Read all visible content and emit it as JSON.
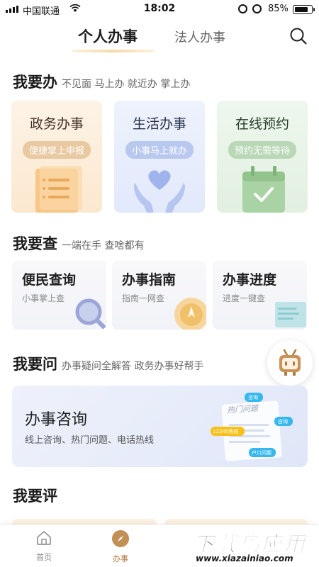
{
  "status_bar": {
    "carrier": "中国联通",
    "time": "18:02",
    "battery": "85%",
    "battery_level": 0.85
  },
  "tabs": {
    "active": "个人办事",
    "inactive": "法人办事"
  },
  "sections": {
    "do": {
      "title": "我要办",
      "subtitle": "不见面 马上办 就近办 掌上办"
    },
    "query": {
      "title": "我要查",
      "subtitle": "一端在手 查啥都有"
    },
    "ask": {
      "title": "我要问",
      "subtitle": "办事疑问全解答 政务办事好帮手"
    },
    "rate": {
      "title": "我要评"
    }
  },
  "do_cards": [
    {
      "title": "政务办事",
      "tag": "便捷掌上申报"
    },
    {
      "title": "生活办事",
      "tag": "小事马上就办"
    },
    {
      "title": "在线预约",
      "tag": "预约无需等待"
    }
  ],
  "query_cards": [
    {
      "title": "便民查询",
      "subtitle": "小事掌上查"
    },
    {
      "title": "办事指南",
      "subtitle": "指南一网查"
    },
    {
      "title": "办事进度",
      "subtitle": "进度一键查"
    }
  ],
  "consult": {
    "title": "办事咨询",
    "subtitle": "线上咨询、热门问题、电话热线",
    "bubbles": {
      "hot": "热门问题",
      "consult": "咨询",
      "guide": "咨询",
      "hotline": "12345热线",
      "faq": "户口问题"
    }
  },
  "bottom_nav": {
    "home": "首页",
    "business": "办事"
  },
  "watermark": {
    "text": "下载鸟应用",
    "url": "www.xiazainiao.com"
  },
  "colors": {
    "accent": "#b07a3e",
    "orange_card": "#fbe8cf",
    "blue_card": "#e2e9fb",
    "green_card": "#e2f0e0"
  }
}
